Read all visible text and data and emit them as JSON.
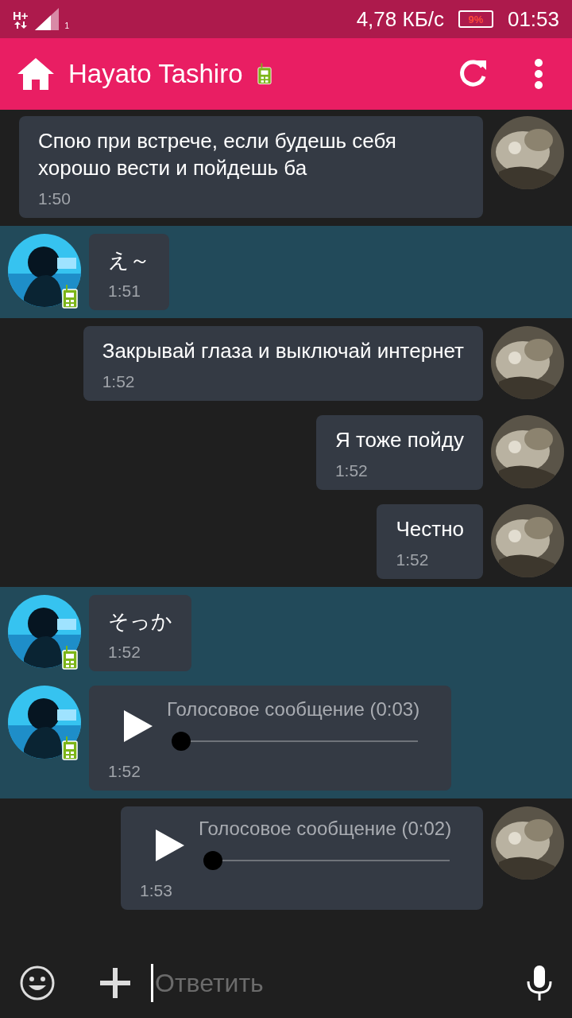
{
  "status_bar": {
    "network": "H+",
    "sim": "1",
    "speed": "4,78 КБ/с",
    "battery": "9%",
    "time": "01:53"
  },
  "header": {
    "title": "Hayato Tashiro"
  },
  "messages": [
    {
      "incoming": false,
      "kind": "text",
      "text": "Спою при встрече, если будешь себя хорошо вести и пойдешь ба",
      "time": "1:50"
    },
    {
      "incoming": true,
      "kind": "text",
      "text": "え～",
      "time": "1:51"
    },
    {
      "incoming": false,
      "kind": "text",
      "text": "Закрывай глаза и выключай интернет",
      "time": "1:52"
    },
    {
      "incoming": false,
      "kind": "text",
      "text": "Я тоже пойду",
      "time": "1:52"
    },
    {
      "incoming": false,
      "kind": "text",
      "text": "Честно",
      "time": "1:52"
    },
    {
      "incoming": true,
      "kind": "text",
      "text": "そっか",
      "time": "1:52"
    },
    {
      "incoming": true,
      "kind": "voice",
      "text": "Голосовое сообщение (0:03)",
      "time": "1:52"
    },
    {
      "incoming": false,
      "kind": "voice",
      "text": "Голосовое сообщение (0:02)",
      "time": "1:53"
    }
  ],
  "composer": {
    "placeholder": "Ответить"
  }
}
